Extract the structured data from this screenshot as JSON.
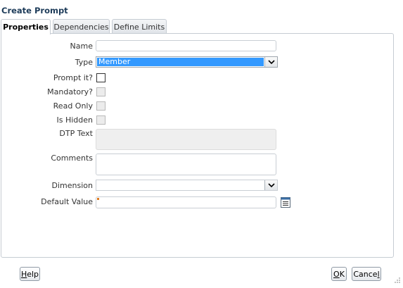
{
  "dialog": {
    "title": "Create Prompt"
  },
  "tabs": [
    {
      "label": "Properties",
      "active": true
    },
    {
      "label": "Dependencies",
      "active": false
    },
    {
      "label": "Define Limits",
      "active": false
    }
  ],
  "form": {
    "name": {
      "label": "Name",
      "value": ""
    },
    "type": {
      "label": "Type",
      "value": "Member"
    },
    "prompt_it": {
      "label": "Prompt it?",
      "checked": false
    },
    "mandatory": {
      "label": "Mandatory?",
      "checked": false,
      "disabled": true
    },
    "read_only": {
      "label": "Read Only",
      "checked": false,
      "disabled": true
    },
    "is_hidden": {
      "label": "Is Hidden",
      "checked": false,
      "disabled": true
    },
    "dtp_text": {
      "label": "DTP Text",
      "value": ""
    },
    "comments": {
      "label": "Comments",
      "value": ""
    },
    "dimension": {
      "label": "Dimension",
      "value": ""
    },
    "default_value": {
      "label": "Default Value",
      "value": ""
    }
  },
  "buttons": {
    "help": {
      "mnemonic": "H",
      "rest": "elp"
    },
    "ok": {
      "mnemonic": "O",
      "rest": "K"
    },
    "cancel": {
      "pre": "Cance",
      "mnemonic": "l"
    }
  },
  "colors": {
    "title": "#1e3c5a",
    "selection": "#3399ff",
    "required_marker": "#e07a1e"
  }
}
